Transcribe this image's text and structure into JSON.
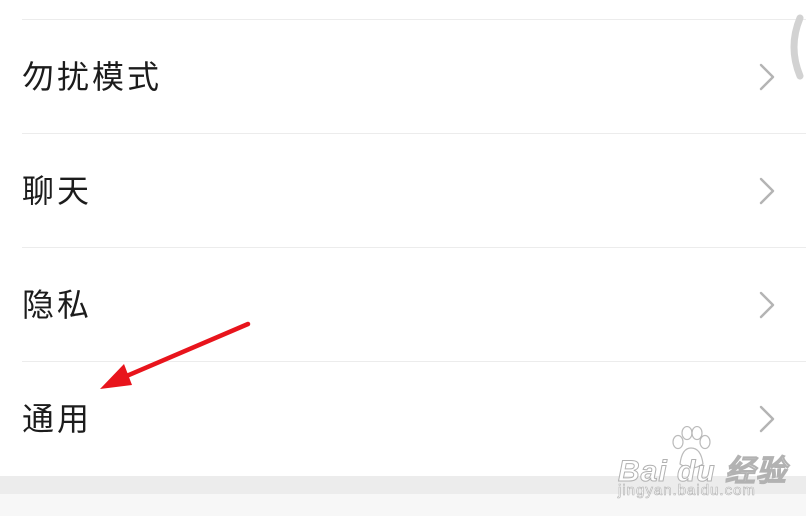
{
  "settings": {
    "items": [
      {
        "label": "勿扰模式",
        "icon": "chevron-right-icon"
      },
      {
        "label": "聊天",
        "icon": "chevron-right-icon"
      },
      {
        "label": "隐私",
        "icon": "chevron-right-icon"
      },
      {
        "label": "通用",
        "icon": "chevron-right-icon"
      }
    ]
  },
  "annotation": {
    "type": "red-arrow",
    "color": "#e8141c",
    "points_to": "通用"
  },
  "watermark": {
    "logo": "Bai du 经验",
    "url": "jingyan.baidu.com"
  },
  "colors": {
    "background": "#ffffff",
    "divider": "#ececec",
    "text": "#1c1c1c",
    "chevron": "#b4b4b4",
    "section_gap": "#ececec"
  }
}
